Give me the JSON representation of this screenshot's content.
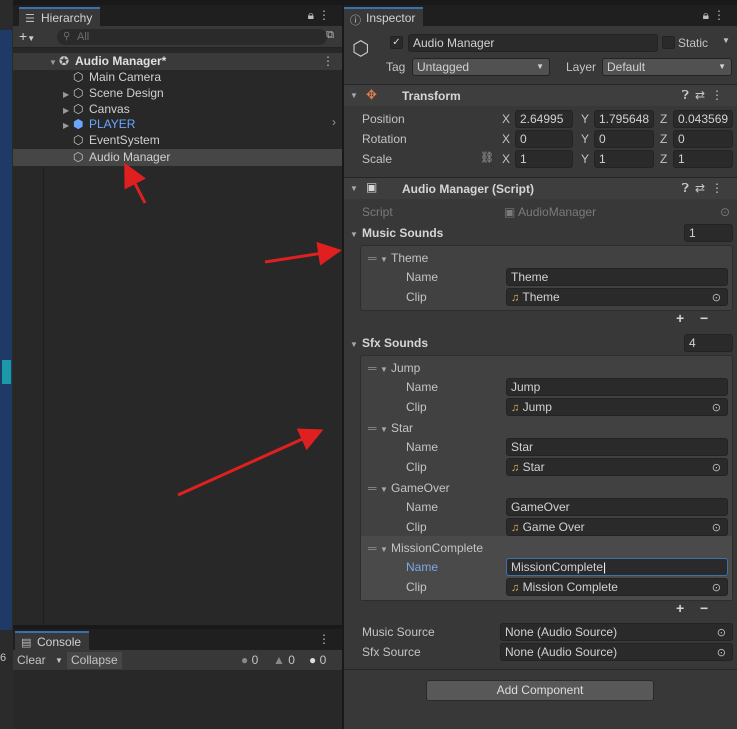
{
  "hierarchy": {
    "tab_label": "Hierarchy",
    "search_placeholder": "All",
    "root": "Audio Manager*",
    "items": [
      "Main Camera",
      "Scene Design",
      "Canvas",
      "PLAYER",
      "EventSystem",
      "Audio Manager"
    ]
  },
  "console": {
    "tab_label": "Console",
    "clear_label": "Clear",
    "collapse_label": "Collapse",
    "counts": [
      "0",
      "0",
      "0"
    ],
    "left_edge_char": "6"
  },
  "inspector": {
    "tab_label": "Inspector",
    "object_name": "Audio Manager",
    "static_label": "Static",
    "tag_label": "Tag",
    "tag_value": "Untagged",
    "layer_label": "Layer",
    "layer_value": "Default",
    "transform": {
      "title": "Transform",
      "position_label": "Position",
      "rotation_label": "Rotation",
      "scale_label": "Scale",
      "position": [
        "2.64995",
        "1.795648",
        "0.043569"
      ],
      "rotation": [
        "0",
        "0",
        "0"
      ],
      "scale": [
        "1",
        "1",
        "1"
      ],
      "axes": [
        "X",
        "Y",
        "Z"
      ]
    },
    "script_component": {
      "title": "Audio Manager (Script)",
      "script_label": "Script",
      "script_value": "AudioManager",
      "music_sounds_label": "Music Sounds",
      "music_sounds_count": "1",
      "music": [
        {
          "element": "Theme",
          "name_label": "Name",
          "name_value": "Theme",
          "clip_label": "Clip",
          "clip_value": "Theme"
        }
      ],
      "sfx_sounds_label": "Sfx Sounds",
      "sfx_sounds_count": "4",
      "sfx": [
        {
          "element": "Jump",
          "name_label": "Name",
          "name_value": "Jump",
          "clip_label": "Clip",
          "clip_value": "Jump"
        },
        {
          "element": "Star",
          "name_label": "Name",
          "name_value": "Star",
          "clip_label": "Clip",
          "clip_value": "Star"
        },
        {
          "element": "GameOver",
          "name_label": "Name",
          "name_value": "GameOver",
          "clip_label": "Clip",
          "clip_value": "Game Over"
        },
        {
          "element": "MissionComplete",
          "name_label": "Name",
          "name_value": "MissionComplete",
          "clip_label": "Clip",
          "clip_value": "Mission Complete"
        }
      ],
      "music_source_label": "Music Source",
      "music_source_value": "None (Audio Source)",
      "sfx_source_label": "Sfx Source",
      "sfx_source_value": "None (Audio Source)"
    },
    "add_component_label": "Add Component"
  },
  "colors": {
    "accent": "#3a72b0",
    "annotation_arrow": "#e02020",
    "player_text": "#6aa6ff"
  }
}
